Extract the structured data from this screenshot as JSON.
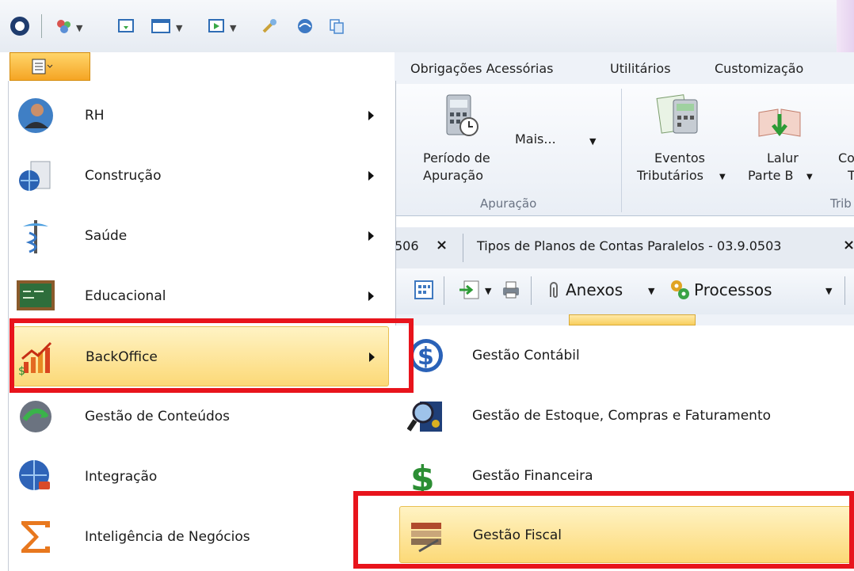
{
  "colors": {
    "highlight_border": "#e8bf52",
    "red_annotation": "#e8141c",
    "file_button": "#f5a524"
  },
  "ribbon": {
    "tabs": [
      "Obrigações Acessórias",
      "Utilitários",
      "Customização"
    ],
    "periodo_line1": "Período de",
    "periodo_line2": "Apuração",
    "mais": "Mais...",
    "group_apuracao": "Apuração",
    "eventos_line1": "Eventos",
    "eventos_line2": "Tributários",
    "lalur_line1": "Lalur",
    "lalur_line2": "Parte B",
    "cut_label1": "Co",
    "cut_label2": "T",
    "group_trib": "Trib"
  },
  "doctabs": {
    "tab1": "506",
    "tab2": "Tipos de Planos de Contas Paralelos - 03.9.0503",
    "close_glyph": "×"
  },
  "doctoolbar": {
    "anexos": "Anexos",
    "processos": "Processos"
  },
  "menu": {
    "items": [
      {
        "label": "RH",
        "icon": "person-icon"
      },
      {
        "label": "Construção",
        "icon": "globe-building-icon"
      },
      {
        "label": "Saúde",
        "icon": "caduceus-icon"
      },
      {
        "label": "Educacional",
        "icon": "chalkboard-icon"
      },
      {
        "label": "BackOffice",
        "icon": "growth-chart-icon"
      },
      {
        "label": "Gestão de Conteúdos",
        "icon": "globe-refresh-icon"
      },
      {
        "label": "Integração",
        "icon": "globe-plug-icon"
      },
      {
        "label": "Inteligência de Negócios",
        "icon": "sigma-icon"
      }
    ]
  },
  "submenu": {
    "items": [
      {
        "label": "Gestão Contábil",
        "icon": "dollar-icon"
      },
      {
        "label": "Gestão de Estoque, Compras e Faturamento",
        "icon": "magnifier-chart-icon"
      },
      {
        "label": "Gestão Financeira",
        "icon": "dollar-green-icon"
      },
      {
        "label": "Gestão Fiscal",
        "icon": "books-pen-icon"
      }
    ]
  }
}
